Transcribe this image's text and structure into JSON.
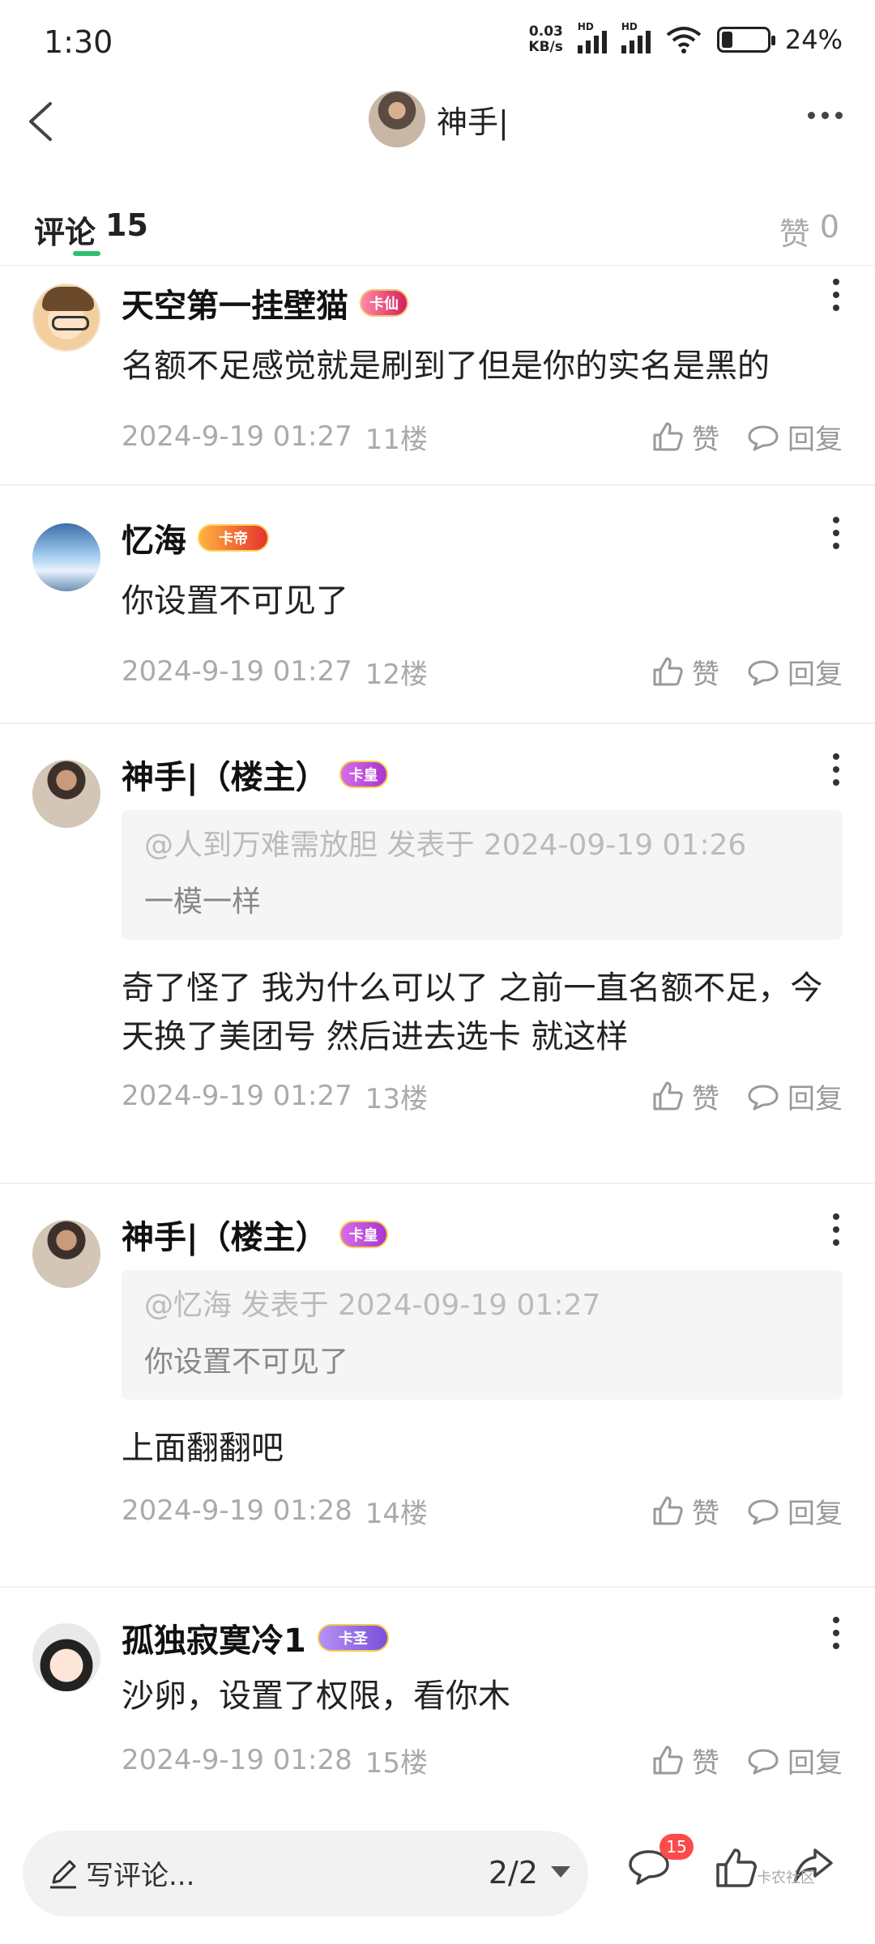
{
  "status": {
    "time": "1:30",
    "net_speed_value": "0.03",
    "net_speed_unit": "KB/s",
    "hd1": "HD",
    "hd2": "HD",
    "battery": "24%",
    "battery_level": 0.24
  },
  "nav": {
    "title": "神手|"
  },
  "tabs": {
    "comments_label": "评论",
    "comments_count": "15",
    "likes_label": "赞",
    "likes_count": "0"
  },
  "comments": [
    {
      "name": "天空第一挂壁猫",
      "badge": "卡仙",
      "text": "名额不足感觉就是刷到了但是你的实名是黑的",
      "date": "2024-9-19 01:27",
      "floor": "11楼",
      "like": "赞",
      "reply": "回复"
    },
    {
      "name": "忆海",
      "badge": "卡帝",
      "text": "你设置不可见了",
      "date": "2024-9-19 01:27",
      "floor": "12楼",
      "like": "赞",
      "reply": "回复"
    },
    {
      "name": "神手|（楼主）",
      "badge": "卡皇",
      "quote_head": "@人到万难需放胆 发表于 2024-09-19 01:26",
      "quote_text": "一模一样",
      "text": "奇了怪了  我为什么可以了 之前一直名额不足，今天换了美团号 然后进去选卡 就这样",
      "date": "2024-9-19 01:27",
      "floor": "13楼",
      "like": "赞",
      "reply": "回复"
    },
    {
      "name": "神手|（楼主）",
      "badge": "卡皇",
      "quote_head": "@忆海 发表于 2024-09-19 01:27",
      "quote_text": "你设置不可见了",
      "text": "上面翻翻吧",
      "date": "2024-9-19 01:28",
      "floor": "14楼",
      "like": "赞",
      "reply": "回复"
    },
    {
      "name": "孤独寂寞冷1",
      "badge": "卡圣",
      "text": "沙卵，设置了权限，看你木",
      "date": "2024-9-19 01:28",
      "floor": "15楼",
      "like": "赞",
      "reply": "回复"
    }
  ],
  "bottom": {
    "placeholder": "写评论...",
    "page": "2/2",
    "comment_count": "15",
    "watermark": "卡农社区"
  },
  "icons": {
    "back": "back-arrow-icon",
    "more": "more-icon",
    "like": "thumb-up-icon",
    "reply": "comment-bubble-icon",
    "pen": "pen-icon",
    "share": "share-icon"
  },
  "colors": {
    "accent": "#2dbf6e",
    "badge_count": "#ff4a4a"
  }
}
